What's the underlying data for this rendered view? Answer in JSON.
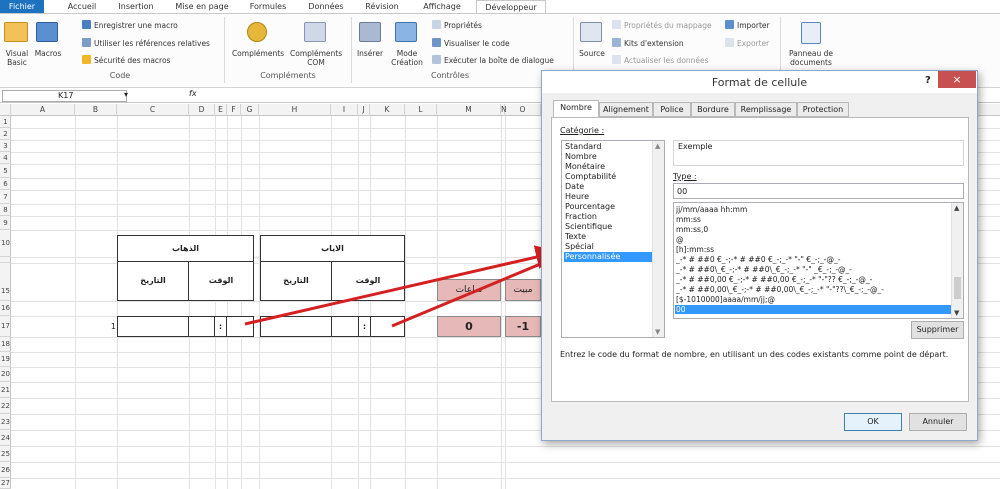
{
  "ribbon": {
    "tabs": [
      "Fichier",
      "Accueil",
      "Insertion",
      "Mise en page",
      "Formules",
      "Données",
      "Révision",
      "Affichage",
      "Développeur"
    ],
    "active_tab": "Développeur",
    "groups": {
      "code": {
        "label": "Code",
        "visual_basic": "Visual Basic",
        "macros": "Macros",
        "record_macro": "Enregistrer une macro",
        "relative_refs": "Utiliser les références relatives",
        "macro_security": "Sécurité des macros"
      },
      "complements": {
        "label": "Compléments",
        "complements": "Compléments",
        "com": "Compléments COM"
      },
      "controles": {
        "label": "Contrôles",
        "inserer": "Insérer",
        "mode_creation": "Mode Création",
        "proprietes": "Propriétés",
        "visualiser_code": "Visualiser le code",
        "executer_boite": "Exécuter la boîte de dialogue"
      },
      "xml": {
        "source": "Source",
        "proprietes_mappage": "Propriétés du mappage",
        "kits_extension": "Kits d'extension",
        "actualiser": "Actualiser les données",
        "importer": "Importer",
        "exporter": "Exporter"
      },
      "modifier": {
        "panneau": "Panneau de documents"
      }
    }
  },
  "formula_bar": {
    "name_box": "K17",
    "fx": "fx"
  },
  "grid": {
    "columns": [
      "A",
      "B",
      "C",
      "D",
      "E",
      "F",
      "G",
      "H",
      "I",
      "J",
      "K",
      "L",
      "M",
      "N",
      "O"
    ],
    "rows": [
      "1",
      "2",
      "3",
      "4",
      "5",
      "6",
      "7",
      "8",
      "9",
      "10",
      "",
      "15",
      "16",
      "17",
      "18",
      "19",
      "20",
      "21",
      "22",
      "23",
      "24",
      "25",
      "26",
      "27"
    ],
    "table_left": {
      "header": "الذهاب",
      "date": "التاريخ",
      "time": "الوقت",
      "colon": ":"
    },
    "table_right": {
      "header": "الاياب",
      "date": "التاريخ",
      "time": "الوقت",
      "colon": ":"
    },
    "row17_b": "1",
    "pink_labels": {
      "m15": "ساعات",
      "o15": "مبيت"
    },
    "pink_values": {
      "m17": "0",
      "o17": "-1"
    }
  },
  "dialog": {
    "title": "Format de cellule",
    "help": "?",
    "close": "×",
    "tabs": [
      "Nombre",
      "Alignement",
      "Police",
      "Bordure",
      "Remplissage",
      "Protection"
    ],
    "active_tab": "Nombre",
    "category_label": "Catégorie :",
    "categories": [
      "Standard",
      "Nombre",
      "Monétaire",
      "Comptabilité",
      "Date",
      "Heure",
      "Pourcentage",
      "Fraction",
      "Scientifique",
      "Texte",
      "Spécial",
      "Personnalisée"
    ],
    "selected_category": "Personnalisée",
    "sample_label": "Exemple",
    "type_label": "Type :",
    "type_value": "00",
    "formats": [
      "jj/mm/aaaa hh:mm",
      "mm:ss",
      "mm:ss,0",
      "@",
      "[h]:mm:ss",
      "_-* # ##0 €_-;-* # ##0 €_-;_-* \"-\" €_-;_-@_-",
      "_-* # ##0\\_€_-;-* # ##0\\_€_-;_-* \"-\" _€_-;_-@_-",
      "_-* # ##0,00 €_-;-* # ##0,00 €_-;_-* \"-\"?? €_-;_-@_-",
      "_-* # ##0,00\\_€_-;-* # ##0,00\\_€_-;_-* \"-\"??\\_€_-;_-@_-",
      "[$-1010000]aaaa/mm/jj;@",
      "00"
    ],
    "selected_format": "00",
    "delete_button": "Supprimer",
    "hint": "Entrez le code du format de nombre, en utilisant un des codes existants comme point de départ.",
    "ok": "OK",
    "cancel": "Annuler"
  },
  "colors": {
    "file_tab": "#1e73c1",
    "selection": "#3399ff",
    "pink_cell": "#e6b8b7",
    "arrow": "#d42020",
    "close_button": "#c75050"
  }
}
